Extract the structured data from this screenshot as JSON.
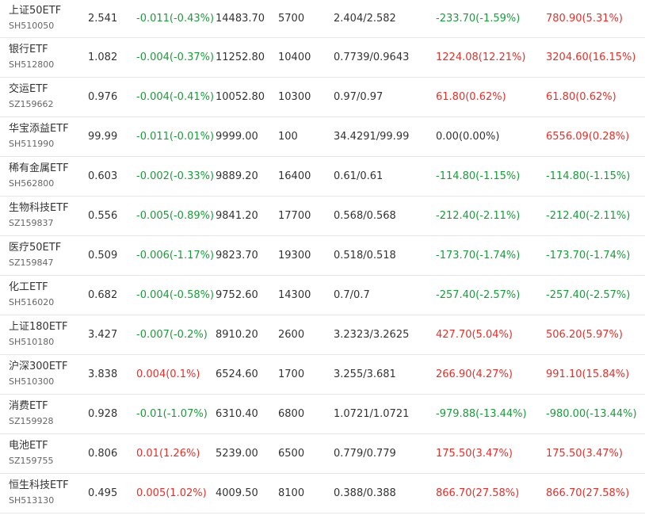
{
  "colors": {
    "up": "#e5302a",
    "down": "#1b9c3b",
    "text": "#333333",
    "code": "#666666",
    "divider": "#e6e6e6"
  },
  "rows": [
    {
      "name": "上证50ETF",
      "code": "SH510050",
      "price": "2.541",
      "change": "-0.011(-0.43%)",
      "change_dir": "down",
      "amount": "14483.70",
      "volume": "5700",
      "cost": "2.404/2.582",
      "pnl1": "-233.70(-1.59%)",
      "pnl1_dir": "down",
      "pnl2": "780.90(5.31%)",
      "pnl2_dir": "up"
    },
    {
      "name": "银行ETF",
      "code": "SH512800",
      "price": "1.082",
      "change": "-0.004(-0.37%)",
      "change_dir": "down",
      "amount": "11252.80",
      "volume": "10400",
      "cost": "0.7739/0.9643",
      "pnl1": "1224.08(12.21%)",
      "pnl1_dir": "up",
      "pnl2": "3204.60(16.15%)",
      "pnl2_dir": "up"
    },
    {
      "name": "交运ETF",
      "code": "SZ159662",
      "price": "0.976",
      "change": "-0.004(-0.41%)",
      "change_dir": "down",
      "amount": "10052.80",
      "volume": "10300",
      "cost": "0.97/0.97",
      "pnl1": "61.80(0.62%)",
      "pnl1_dir": "up",
      "pnl2": "61.80(0.62%)",
      "pnl2_dir": "up"
    },
    {
      "name": "华宝添益ETF",
      "code": "SH511990",
      "price": "99.99",
      "change": "-0.011(-0.01%)",
      "change_dir": "down",
      "amount": "9999.00",
      "volume": "100",
      "cost": "34.4291/99.99",
      "pnl1": "0.00(0.00%)",
      "pnl1_dir": "flat",
      "pnl2": "6556.09(0.28%)",
      "pnl2_dir": "up"
    },
    {
      "name": "稀有金属ETF",
      "code": "SH562800",
      "price": "0.603",
      "change": "-0.002(-0.33%)",
      "change_dir": "down",
      "amount": "9889.20",
      "volume": "16400",
      "cost": "0.61/0.61",
      "pnl1": "-114.80(-1.15%)",
      "pnl1_dir": "down",
      "pnl2": "-114.80(-1.15%)",
      "pnl2_dir": "down"
    },
    {
      "name": "生物科技ETF",
      "code": "SZ159837",
      "price": "0.556",
      "change": "-0.005(-0.89%)",
      "change_dir": "down",
      "amount": "9841.20",
      "volume": "17700",
      "cost": "0.568/0.568",
      "pnl1": "-212.40(-2.11%)",
      "pnl1_dir": "down",
      "pnl2": "-212.40(-2.11%)",
      "pnl2_dir": "down"
    },
    {
      "name": "医疗50ETF",
      "code": "SZ159847",
      "price": "0.509",
      "change": "-0.006(-1.17%)",
      "change_dir": "down",
      "amount": "9823.70",
      "volume": "19300",
      "cost": "0.518/0.518",
      "pnl1": "-173.70(-1.74%)",
      "pnl1_dir": "down",
      "pnl2": "-173.70(-1.74%)",
      "pnl2_dir": "down"
    },
    {
      "name": "化工ETF",
      "code": "SH516020",
      "price": "0.682",
      "change": "-0.004(-0.58%)",
      "change_dir": "down",
      "amount": "9752.60",
      "volume": "14300",
      "cost": "0.7/0.7",
      "pnl1": "-257.40(-2.57%)",
      "pnl1_dir": "down",
      "pnl2": "-257.40(-2.57%)",
      "pnl2_dir": "down"
    },
    {
      "name": "上证180ETF",
      "code": "SH510180",
      "price": "3.427",
      "change": "-0.007(-0.2%)",
      "change_dir": "down",
      "amount": "8910.20",
      "volume": "2600",
      "cost": "3.2323/3.2625",
      "pnl1": "427.70(5.04%)",
      "pnl1_dir": "up",
      "pnl2": "506.20(5.97%)",
      "pnl2_dir": "up"
    },
    {
      "name": "沪深300ETF",
      "code": "SH510300",
      "price": "3.838",
      "change": "0.004(0.1%)",
      "change_dir": "up",
      "amount": "6524.60",
      "volume": "1700",
      "cost": "3.255/3.681",
      "pnl1": "266.90(4.27%)",
      "pnl1_dir": "up",
      "pnl2": "991.10(15.84%)",
      "pnl2_dir": "up"
    },
    {
      "name": "消费ETF",
      "code": "SZ159928",
      "price": "0.928",
      "change": "-0.01(-1.07%)",
      "change_dir": "down",
      "amount": "6310.40",
      "volume": "6800",
      "cost": "1.0721/1.0721",
      "pnl1": "-979.88(-13.44%)",
      "pnl1_dir": "down",
      "pnl2": "-980.00(-13.44%)",
      "pnl2_dir": "down"
    },
    {
      "name": "电池ETF",
      "code": "SZ159755",
      "price": "0.806",
      "change": "0.01(1.26%)",
      "change_dir": "up",
      "amount": "5239.00",
      "volume": "6500",
      "cost": "0.779/0.779",
      "pnl1": "175.50(3.47%)",
      "pnl1_dir": "up",
      "pnl2": "175.50(3.47%)",
      "pnl2_dir": "up"
    },
    {
      "name": "恒生科技ETF",
      "code": "SH513130",
      "price": "0.495",
      "change": "0.005(1.02%)",
      "change_dir": "up",
      "amount": "4009.50",
      "volume": "8100",
      "cost": "0.388/0.388",
      "pnl1": "866.70(27.58%)",
      "pnl1_dir": "up",
      "pnl2": "866.70(27.58%)",
      "pnl2_dir": "up"
    }
  ]
}
